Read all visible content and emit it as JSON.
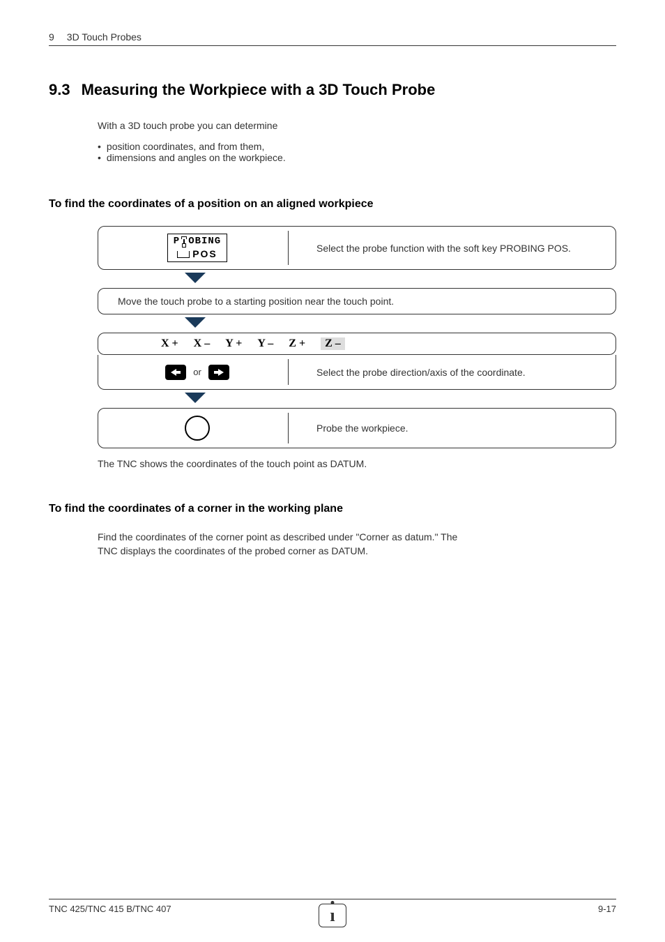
{
  "header": {
    "chapter_num": "9",
    "chapter_title": "3D Touch Probes"
  },
  "section": {
    "number": "9.3",
    "title": "Measuring the Workpiece with a 3D Touch Probe"
  },
  "intro": "With a 3D touch probe you can determine",
  "bullets": [
    "position coordinates, and from them,",
    "dimensions and angles on the workpiece."
  ],
  "sub1": {
    "heading": "To find the coordinates of a position on an aligned workpiece",
    "softkey": {
      "line1": "PROBING",
      "line2": "POS"
    },
    "step1_text": "Select the probe function with the soft key PROBING POS.",
    "step2_text": "Move the touch probe to a starting position near the touch point.",
    "axes": [
      "X +",
      "X –",
      "Y +",
      "Y –",
      "Z +",
      "Z –"
    ],
    "step3_or": "or",
    "step3_text": "Select the probe direction/axis of the coordinate.",
    "step4_text": "Probe the workpiece.",
    "after": "The TNC shows the coordinates of the touch point as DATUM."
  },
  "sub2": {
    "heading": "To find the coordinates of a corner in the working plane",
    "para": "Find the coordinates of the corner point as described under \"Corner as datum.\" The TNC displays the coordinates of the probed corner as DATUM."
  },
  "footer": {
    "left": "TNC 425/TNC 415 B/TNC 407",
    "right": "9-17",
    "info_icon": "i"
  }
}
